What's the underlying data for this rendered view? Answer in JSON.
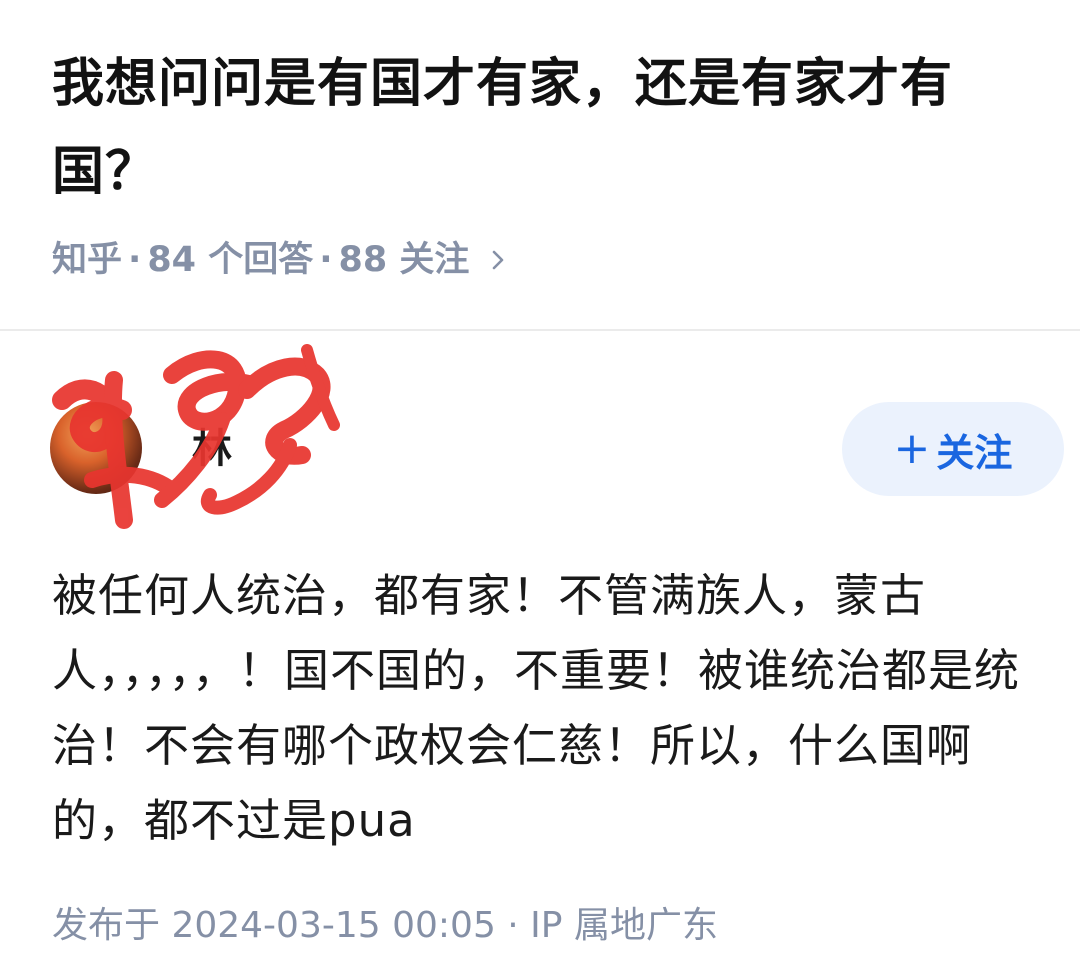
{
  "question": {
    "title": "我想问问是有国才有家，还是有家才有国？",
    "meta": {
      "source": "知乎",
      "separator": "·",
      "answers": "84 个回答",
      "followers": "88 关注",
      "chevron_icon": "chevron-right-icon"
    }
  },
  "answer": {
    "author": {
      "name": "林",
      "avatar_icon": "user-avatar",
      "redaction": "red-scribble-over-name"
    },
    "follow_button": {
      "plus": "+",
      "label": "关注"
    },
    "content": "被任何人统治，都有家！不管满族人，蒙古人，，，，，！国不国的，不重要！被谁统治都是统治！不会有哪个政权会仁慈！所以，什么国啊的，都不过是pua",
    "meta": "发布于 2024-03-15 00:05 · IP 属地广东"
  },
  "colors": {
    "title": "#121212",
    "meta_gray": "#8590a6",
    "follow_bg": "#ebf2fd",
    "follow_text": "#1a66e0",
    "divider": "#ebebeb",
    "scribble": "#e8352f"
  }
}
